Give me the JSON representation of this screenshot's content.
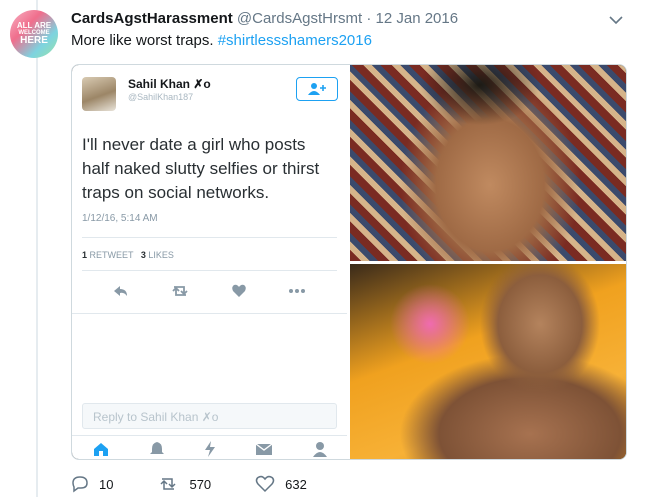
{
  "tweet": {
    "display_name": "CardsAgstHarassment",
    "handle": "@CardsAgstHrsmt",
    "separator": " · ",
    "date": "12 Jan 2016",
    "text": "More like worst traps. ",
    "hashtag": "#shirtlessshamers2016",
    "avatar_text": [
      "ALL ARE",
      "WELCOME",
      "HERE"
    ],
    "reply_count": "10",
    "retweet_count": "570",
    "like_count": "632"
  },
  "embedded": {
    "display_name": "Sahil Khan ✗o",
    "handle": "@SahilKhan187",
    "text": "I'll never date a girl who posts half naked slutty selfies or thirst traps on social networks.",
    "timestamp": "1/12/16, 5:14 AM",
    "retweets_num": "1",
    "retweets_label": "RETWEET",
    "likes_num": "3",
    "likes_label": "LIKES",
    "reply_placeholder": "Reply to Sahil Khan ✗o"
  },
  "colors": {
    "accent": "#1da1f2",
    "muted": "#657786"
  }
}
